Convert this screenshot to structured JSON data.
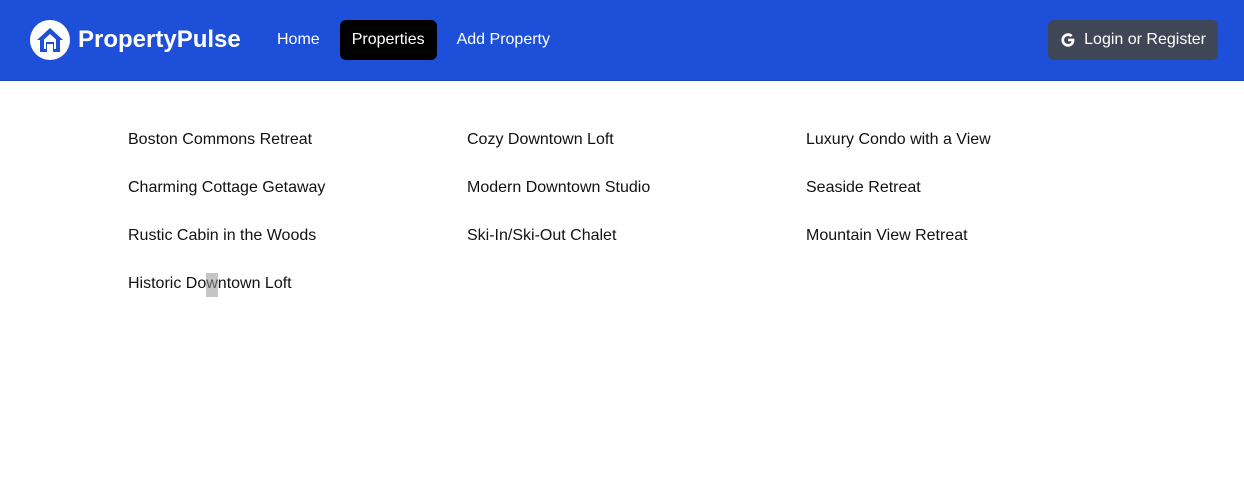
{
  "header": {
    "brand": "PropertyPulse",
    "nav": [
      {
        "label": "Home",
        "active": false
      },
      {
        "label": "Properties",
        "active": true
      },
      {
        "label": "Add Property",
        "active": false
      }
    ],
    "login_label": "Login or Register",
    "login_icon": "google-icon",
    "brand_icon": "house-icon",
    "colors": {
      "navbar": "#1d4fd8",
      "active_tab": "#000000",
      "login_button": "#3f4756"
    }
  },
  "properties": [
    "Boston Commons Retreat",
    "Cozy Downtown Loft",
    "Luxury Condo with a View",
    "Charming Cottage Getaway",
    "Modern Downtown Studio",
    "Seaside Retreat",
    "Rustic Cabin in the Woods",
    "Ski-In/Ski-Out Chalet",
    "Mountain View Retreat",
    "Historic Downtown Loft"
  ]
}
